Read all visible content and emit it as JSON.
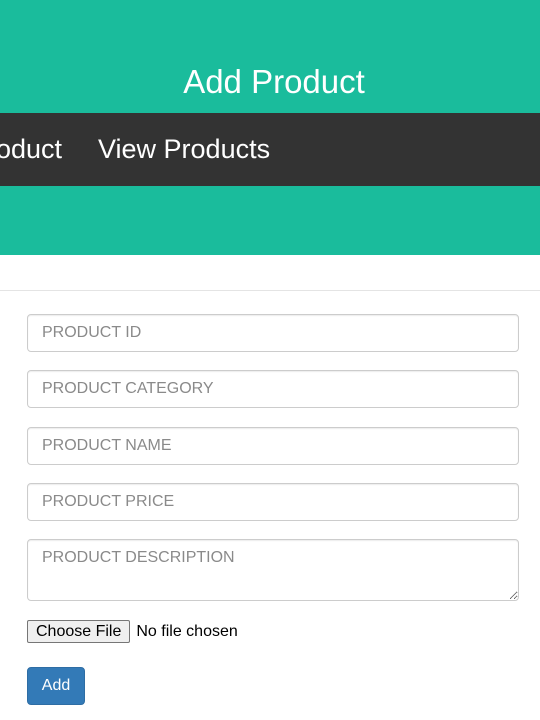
{
  "header": {
    "title": "Add Product"
  },
  "nav": {
    "items": [
      {
        "label": "Add Product"
      },
      {
        "label": "View Products"
      }
    ]
  },
  "form": {
    "product_id": {
      "placeholder": "PRODUCT ID",
      "value": ""
    },
    "product_category": {
      "placeholder": "PRODUCT CATEGORY",
      "value": ""
    },
    "product_name": {
      "placeholder": "PRODUCT NAME",
      "value": ""
    },
    "product_price": {
      "placeholder": "PRODUCT PRICE",
      "value": ""
    },
    "product_description": {
      "placeholder": "PRODUCT DESCRIPTION",
      "value": ""
    },
    "file": {
      "button_label": "Choose File",
      "status": "No file chosen"
    },
    "submit_label": "Add"
  },
  "colors": {
    "header_bg": "#1abc9c",
    "navbar_bg": "#333333",
    "primary_button": "#337ab7"
  }
}
